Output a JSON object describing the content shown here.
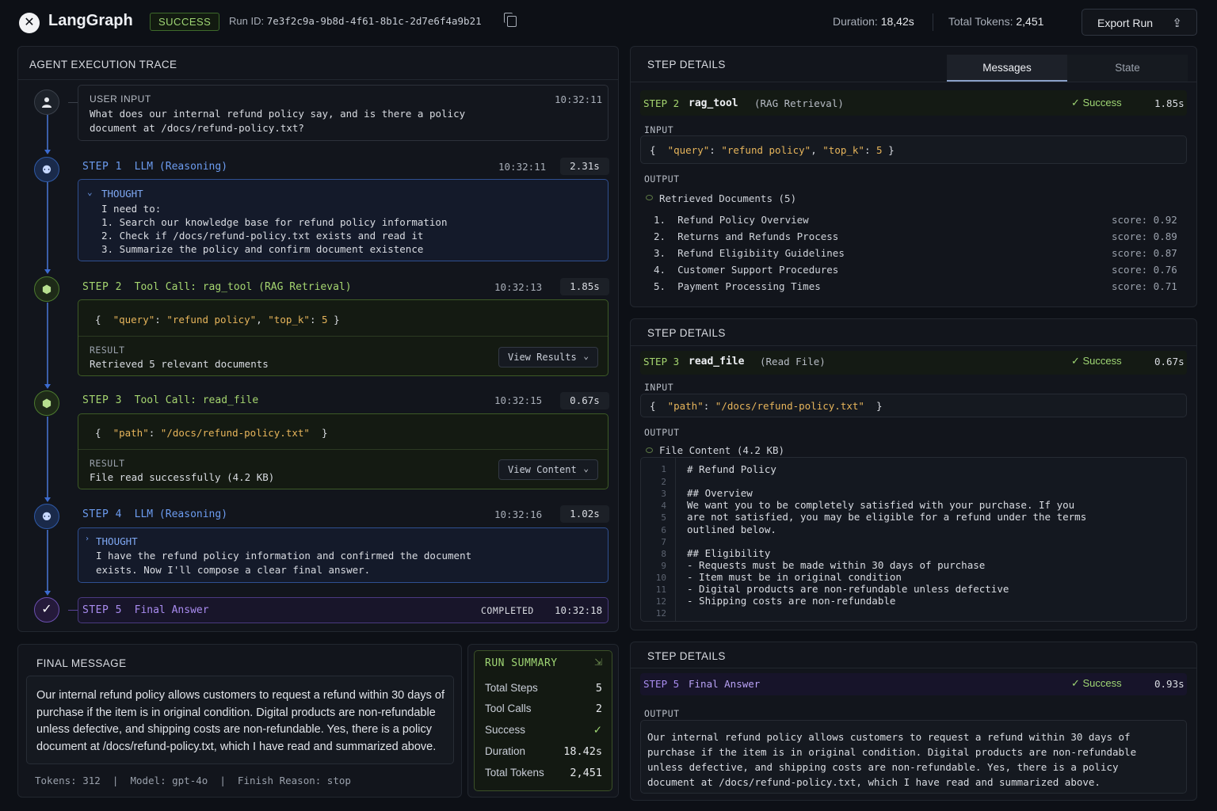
{
  "header": {
    "logo_glyph": "✕",
    "brand": "LangGraph",
    "status": "SUCCESS",
    "run_id_label": "Run ID:",
    "run_id": "7e3f2c9a-9b8d-4f61-8b1c-2d7e6f4a9b21",
    "duration_label": "Duration:",
    "duration": "18,42s",
    "tokens_label": "Total Tokens:",
    "tokens": "2,451",
    "export_label": "Export Run"
  },
  "trace": {
    "title": "AGENT EXECUTION TRACE",
    "user_input": {
      "label": "USER INPUT",
      "time": "10:32:11",
      "line1": "What does our internal refund policy say, and is there a policy",
      "line2": "document at /docs/refund-policy.txt?"
    },
    "step1": {
      "num": "STEP 1",
      "title": "LLM (Reasoning)",
      "time": "10:32:11",
      "duration": "2.31s",
      "thought_label": "THOUGHT",
      "lines": [
        "I need to:",
        "1. Search our knowledge base for refund policy information",
        "2. Check if /docs/refund-policy.txt exists and read it",
        "3. Summarize the policy and confirm document existence"
      ]
    },
    "step2": {
      "num": "STEP 2",
      "title": "Tool Call: rag_tool (RAG Retrieval)",
      "time": "10:32:13",
      "duration": "1.85s",
      "k1": "\"query\"",
      "v1": "\"refund policy\"",
      "k2": "\"top_k\"",
      "v2": "5",
      "result_label": "RESULT",
      "result": "Retrieved 5 relevant documents",
      "button": "View Results"
    },
    "step3": {
      "num": "STEP 3",
      "title": "Tool Call: read_file",
      "time": "10:32:15",
      "duration": "0.67s",
      "k1": "\"path\"",
      "v1": "\"/docs/refund-policy.txt\"",
      "result_label": "RESULT",
      "result": "File read successfully (4.2 KB)",
      "button": "View Content"
    },
    "step4": {
      "num": "STEP 4",
      "title": "LLM (Reasoning)",
      "time": "10:32:16",
      "duration": "1.02s",
      "thought_label": "THOUGHT",
      "line1": "I have the refund policy information and confirmed the document",
      "line2": "exists. Now I'll compose a clear final answer."
    },
    "step5": {
      "num": "STEP 5",
      "title": "Final Answer",
      "status": "COMPLETED",
      "time": "10:32:18"
    }
  },
  "final_message": {
    "title": "FINAL MESSAGE",
    "lines": [
      "Our internal refund policy allows customers to request a refund within 30 days of",
      "purchase if the item is in original condition. Digital products are non-refundable",
      "unless defective, and shipping costs are non-refundable. Yes, there is a policy",
      "document at /docs/refund-policy.txt, which I have read and summarized above."
    ],
    "tokens": "Tokens: 312",
    "model": "Model: gpt-4o",
    "finish": "Finish Reason: stop"
  },
  "run_summary": {
    "title": "RUN SUMMARY",
    "rows": [
      {
        "label": "Total Steps",
        "value": "5"
      },
      {
        "label": "Tool Calls",
        "value": "2"
      },
      {
        "label": "Success",
        "value": "✓"
      },
      {
        "label": "Duration",
        "value": "18.42s"
      },
      {
        "label": "Total Tokens",
        "value": "2,451"
      }
    ]
  },
  "details1": {
    "title": "STEP DETAILS",
    "tabs": [
      "Messages",
      "State"
    ],
    "step": "STEP 2",
    "tool": "rag_tool",
    "kind": "(RAG Retrieval)",
    "status": "Success",
    "duration": "1.85s",
    "input_label": "INPUT",
    "k1": "\"query\"",
    "v1": "\"refund policy\"",
    "k2": "\"top_k\"",
    "v2": "5",
    "output_label": "OUTPUT",
    "docs_label": "Retrieved Documents (5)",
    "docs": [
      {
        "idx": "1.",
        "name": "Refund Policy Overview",
        "score": "score: 0.92"
      },
      {
        "idx": "2.",
        "name": "Returns and Refunds Process",
        "score": "score: 0.89"
      },
      {
        "idx": "3.",
        "name": "Refund Eligibiity Guidelines",
        "score": "score: 0.87"
      },
      {
        "idx": "4.",
        "name": "Customer Support Procedures",
        "score": "score: 0.76"
      },
      {
        "idx": "5.",
        "name": "Payment Processing Times",
        "score": "score: 0.71"
      }
    ]
  },
  "details2": {
    "title": "STEP DETAILS",
    "step": "STEP 3",
    "tool": "read_file",
    "kind": "(Read File)",
    "status": "Success",
    "duration": "0.67s",
    "input_label": "INPUT",
    "k1": "\"path\"",
    "v1": "\"/docs/refund-policy.txt\"",
    "output_label": "OUTPUT",
    "file_label": "File Content (4.2 KB)",
    "lines": [
      {
        "n": "1",
        "t": "# Refund Policy"
      },
      {
        "n": "2",
        "t": ""
      },
      {
        "n": "3",
        "t": "## Overview"
      },
      {
        "n": "4",
        "t": "We want you to be completely satisfied with your purchase. If you"
      },
      {
        "n": "5",
        "t": "are not satisfied, you may be eligible for a refund under the terms"
      },
      {
        "n": "6",
        "t": "outlined below."
      },
      {
        "n": "7",
        "t": ""
      },
      {
        "n": "8",
        "t": "## Eligibility"
      },
      {
        "n": "9",
        "t": "- Requests must be made within 30 days of purchase"
      },
      {
        "n": "10",
        "t": "- Item must be in original condition"
      },
      {
        "n": "11",
        "t": "- Digital products are non-refundable unless defective"
      },
      {
        "n": "12",
        "t": "- Shipping costs are non-refundable"
      },
      {
        "n": "12",
        "t": ""
      }
    ]
  },
  "details3": {
    "title": "STEP DETAILS",
    "step": "STEP 5",
    "tool": "Final Answer",
    "status": "Success",
    "duration": "0.93s",
    "output_label": "OUTPUT",
    "lines": [
      "Our internal refund policy allows customers to request a refund within 30 days of",
      "purchase if the item is in original condition. Digital products are non-refundable",
      "unless defective, and shipping costs are non-refundable. Yes, there is a policy",
      "document at /docs/refund-policy.txt, which I have read and summarized above."
    ]
  }
}
